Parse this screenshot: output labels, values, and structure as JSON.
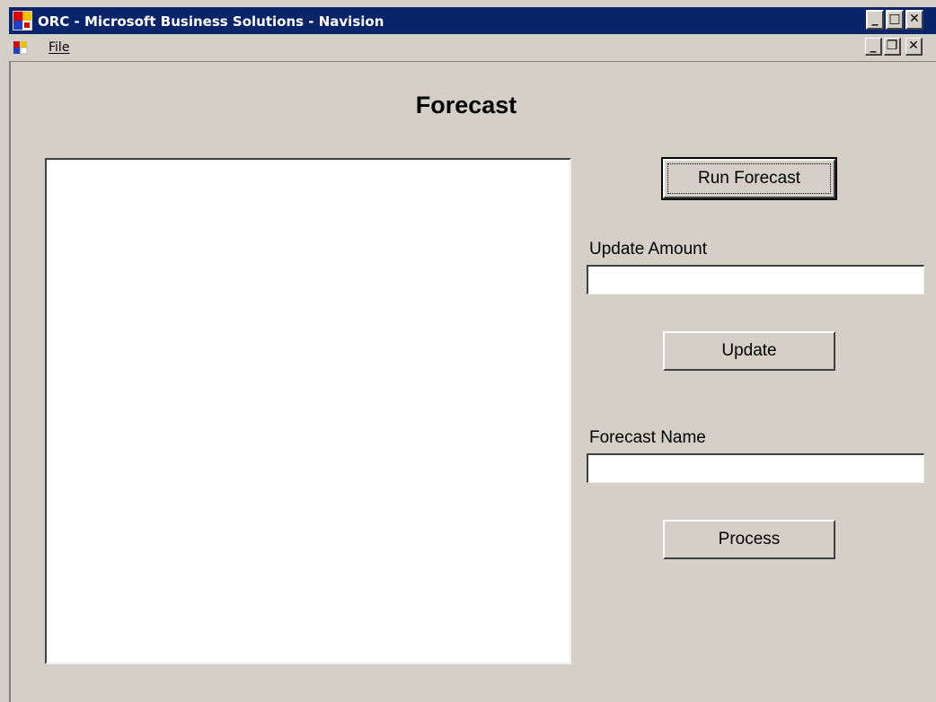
{
  "window": {
    "title": "ORC - Microsoft Business Solutions - Navision",
    "controls": {
      "minimize": "_",
      "maximize": "□",
      "close": "✕"
    }
  },
  "menu": {
    "file_label": "File",
    "doc_controls": {
      "minimize": "_",
      "restore": "❐",
      "close": "✕"
    }
  },
  "form": {
    "title": "Forecast",
    "run_forecast_label": "Run Forecast",
    "update_amount_label": "Update Amount",
    "update_amount_value": "",
    "update_amount_placeholder": "",
    "update_label": "Update",
    "forecast_name_label": "Forecast Name",
    "forecast_name_value": "",
    "forecast_name_placeholder": "",
    "process_label": "Process",
    "results_list": []
  },
  "colors": {
    "titlebar": "#0a246a",
    "face": "#d4d0c8",
    "list_background": "#ffffff"
  },
  "icons": {
    "app": "navision-app-icon",
    "document": "navision-document-icon"
  }
}
